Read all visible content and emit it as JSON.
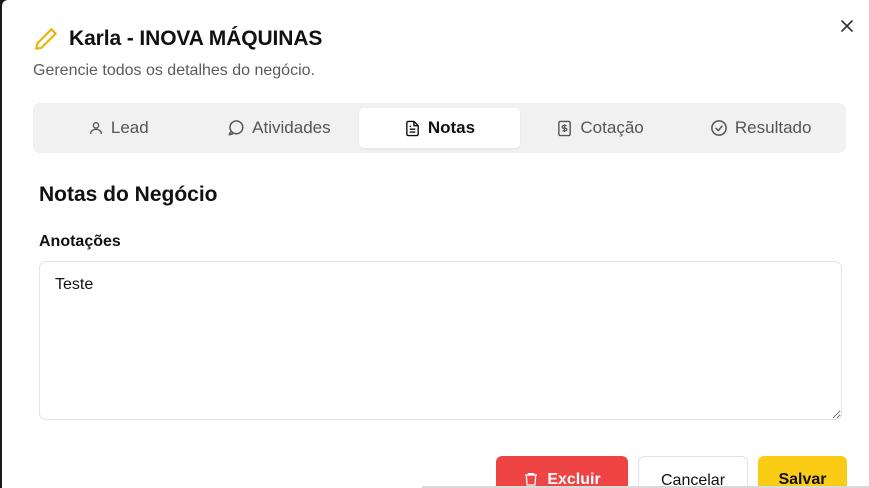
{
  "dialog": {
    "title": "Karla - INOVA MÁQUINAS",
    "subtitle": "Gerencie todos os detalhes do negócio.",
    "title_icon": "pencil-icon",
    "close_icon": "close-icon"
  },
  "tabs": [
    {
      "label": "Lead",
      "icon": "user-icon",
      "active": false
    },
    {
      "label": "Atividades",
      "icon": "message-circle-icon",
      "active": false
    },
    {
      "label": "Notas",
      "icon": "file-text-icon",
      "active": true
    },
    {
      "label": "Cotação",
      "icon": "dollar-document-icon",
      "active": false
    },
    {
      "label": "Resultado",
      "icon": "check-circle-icon",
      "active": false
    }
  ],
  "notes": {
    "section_title": "Notas do Negócio",
    "field_label": "Anotações",
    "value": "Teste"
  },
  "actions": {
    "delete_label": "Excluir",
    "cancel_label": "Cancelar",
    "save_label": "Salvar"
  },
  "colors": {
    "accent": "#facc15",
    "danger": "#ef4444",
    "tab_bar_bg": "#f1f1f1"
  }
}
